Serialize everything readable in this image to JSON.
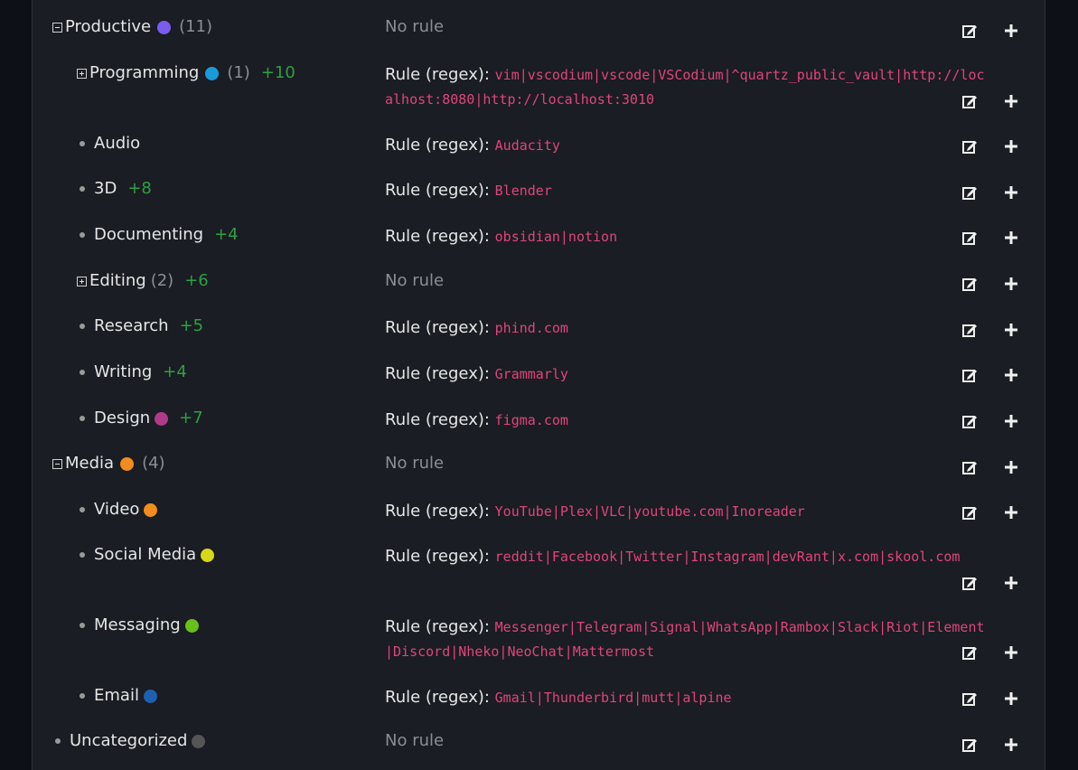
{
  "rows": [
    {
      "name": "Productive",
      "count": "(11)",
      "extra": "",
      "rule_prefix": "",
      "regex": "",
      "no_rule": "No rule"
    },
    {
      "name": "Programming",
      "count": "(1)",
      "extra": "+10",
      "rule_prefix": "Rule (regex): ",
      "regex": "vim|vscodium|vscode|VSCodium|^quartz_public_vault|http://localhost:8080|http://localhost:3010",
      "no_rule": ""
    },
    {
      "name": "Audio",
      "count": "",
      "extra": "",
      "rule_prefix": "Rule (regex): ",
      "regex": "Audacity",
      "no_rule": ""
    },
    {
      "name": "3D",
      "count": "",
      "extra": "+8",
      "rule_prefix": "Rule (regex): ",
      "regex": "Blender",
      "no_rule": ""
    },
    {
      "name": "Documenting",
      "count": "",
      "extra": "+4",
      "rule_prefix": "Rule (regex): ",
      "regex": "obsidian|notion",
      "no_rule": ""
    },
    {
      "name": "Editing",
      "count": "(2)",
      "extra": "+6",
      "rule_prefix": "",
      "regex": "",
      "no_rule": "No rule"
    },
    {
      "name": "Research",
      "count": "",
      "extra": "+5",
      "rule_prefix": "Rule (regex): ",
      "regex": "phind.com",
      "no_rule": ""
    },
    {
      "name": "Writing",
      "count": "",
      "extra": "+4",
      "rule_prefix": "Rule (regex): ",
      "regex": "Grammarly",
      "no_rule": ""
    },
    {
      "name": "Design",
      "count": "",
      "extra": "+7",
      "rule_prefix": "Rule (regex): ",
      "regex": "figma.com",
      "no_rule": ""
    },
    {
      "name": "Media",
      "count": "(4)",
      "extra": "",
      "rule_prefix": "",
      "regex": "",
      "no_rule": "No rule"
    },
    {
      "name": "Video",
      "count": "",
      "extra": "",
      "rule_prefix": "Rule (regex): ",
      "regex": "YouTube|Plex|VLC|youtube.com|Inoreader",
      "no_rule": ""
    },
    {
      "name": "Social Media",
      "count": "",
      "extra": "",
      "rule_prefix": "Rule (regex): ",
      "regex": "reddit|Facebook|Twitter|Instagram|devRant|x.com|skool.com",
      "no_rule": ""
    },
    {
      "name": "Messaging",
      "count": "",
      "extra": "",
      "rule_prefix": "Rule (regex): ",
      "regex": "Messenger|Telegram|Signal|WhatsApp|Rambox|Slack|Riot|Element|Discord|Nheko|NeoChat|Mattermost",
      "no_rule": ""
    },
    {
      "name": "Email",
      "count": "",
      "extra": "",
      "rule_prefix": "Rule (regex): ",
      "regex": "Gmail|Thunderbird|mutt|alpine",
      "no_rule": ""
    },
    {
      "name": "Uncategorized",
      "count": "",
      "extra": "",
      "rule_prefix": "",
      "regex": "",
      "no_rule": "No rule"
    }
  ],
  "colors": {
    "productive": "#7b5cf0",
    "programming": "#1a9ad9",
    "design": "#b03a8a",
    "media": "#f28c1c",
    "video": "#f28c1c",
    "social_media": "#d8d81a",
    "messaging": "#6abf1a",
    "email": "#1f5fb0",
    "uncategorized": "#555555",
    "regex": "#e0457b",
    "extra_count": "#2ea043"
  },
  "icons": {
    "edit": "edit-icon",
    "add": "plus-icon",
    "expand": "expand-toggle-icon",
    "collapse": "collapse-toggle-icon"
  }
}
